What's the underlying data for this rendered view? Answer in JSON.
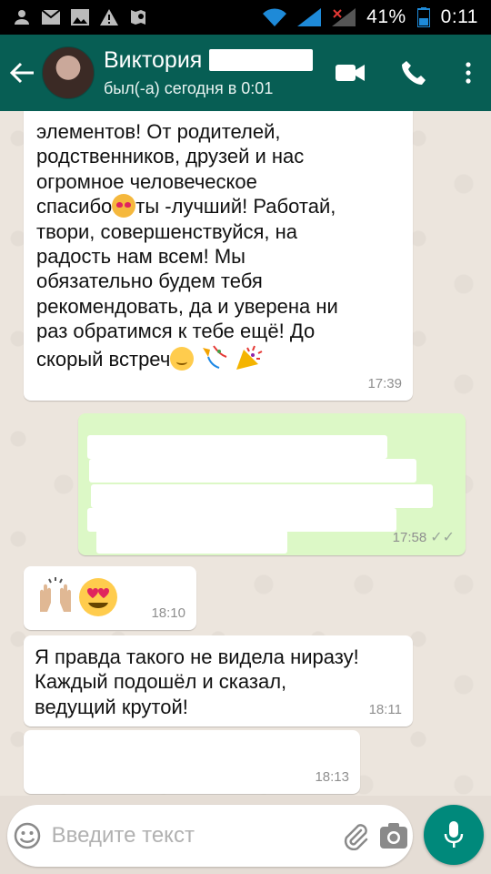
{
  "status_bar": {
    "battery_percent": "41%",
    "time": "0:11"
  },
  "header": {
    "contact_name": "Виктория",
    "last_seen": "был(-а) сегодня в 0:01"
  },
  "messages": [
    {
      "direction": "incoming",
      "lines": [
        "элементов! От родителей,",
        "родственников, друзей и нас",
        "огромное человеческое",
        "спасибо",
        "ты -лучший! Работай,",
        "твори, совершенствуйся, на",
        "радость нам всем! Мы",
        "обязательно будем тебя",
        "рекомендовать, да и уверена ни",
        "раз обратимся к тебе ещё! До",
        "скорый встреч"
      ],
      "time": "17:39"
    },
    {
      "direction": "outgoing",
      "time": "17:58"
    },
    {
      "direction": "incoming",
      "time": "18:10"
    },
    {
      "direction": "incoming",
      "lines": [
        "Я правда такого не видела ниразу!",
        "Каждый подошёл и сказал,",
        "ведущий крутой!"
      ],
      "time": "18:11"
    },
    {
      "direction": "incoming",
      "time": "18:13"
    }
  ],
  "input": {
    "placeholder": "Введите текст"
  },
  "colors": {
    "header": "#075e54",
    "outgoing_bubble": "#dcf8c6",
    "incoming_bubble": "#ffffff",
    "mic_button": "#00897b"
  }
}
